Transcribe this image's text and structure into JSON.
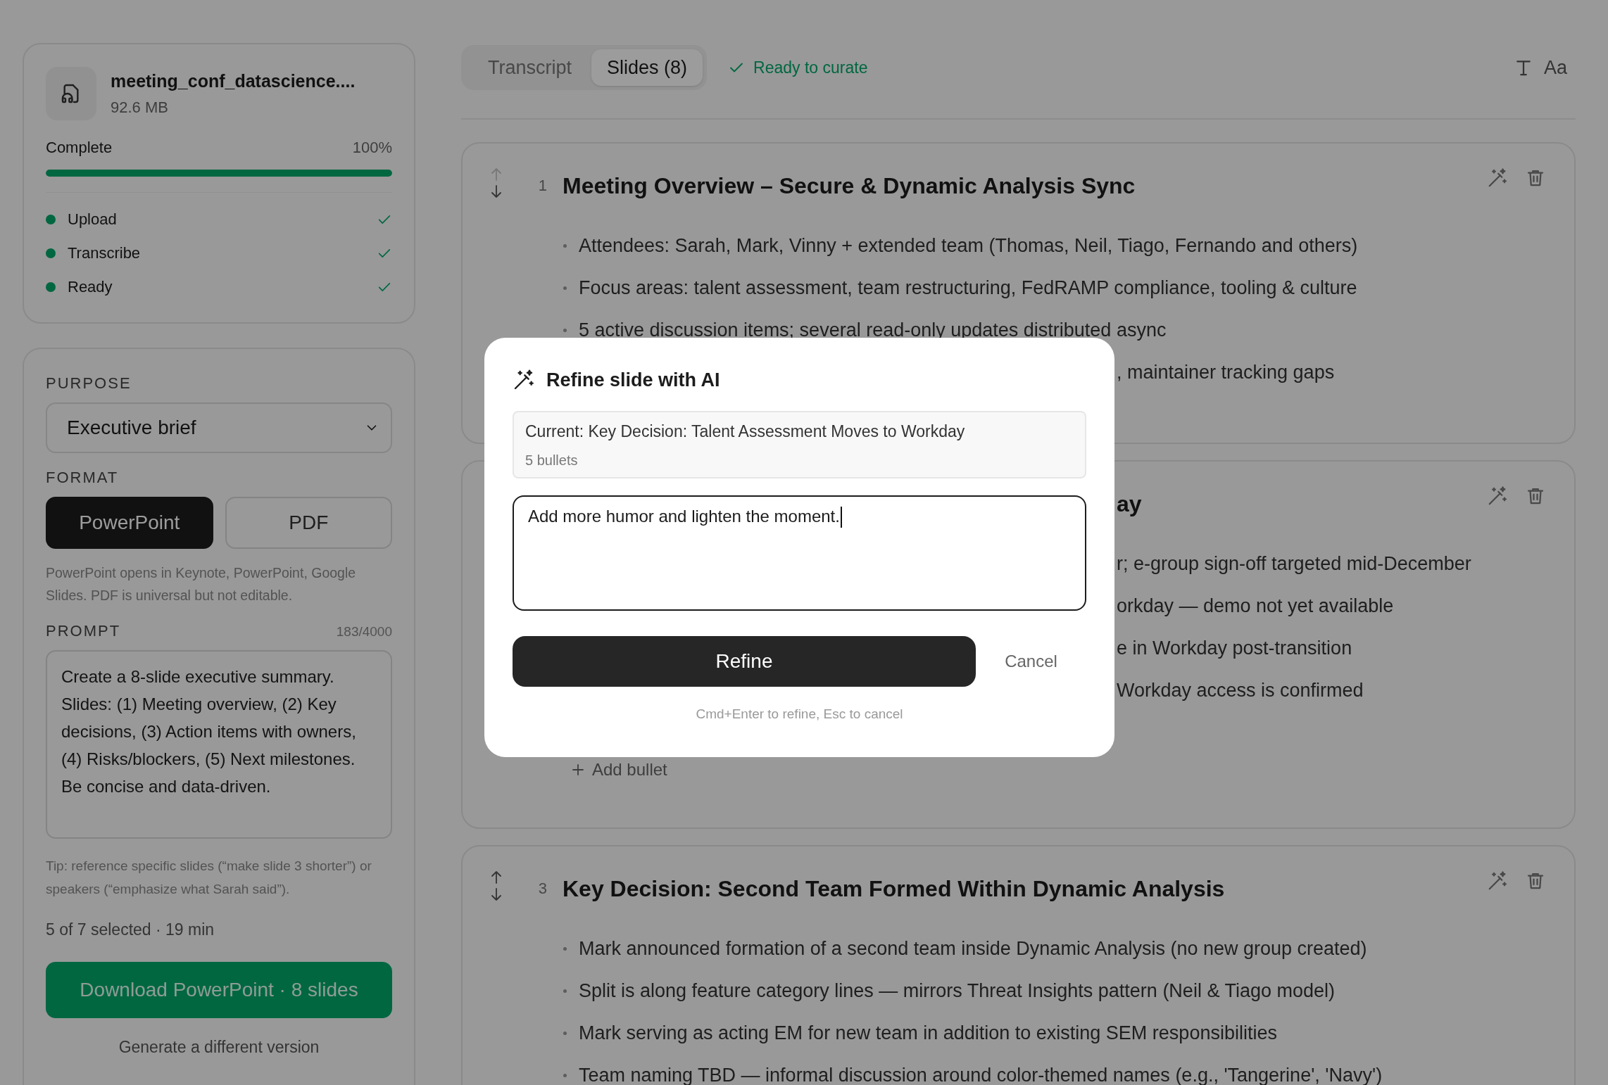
{
  "sidebar": {
    "file": {
      "name": "meeting_conf_datascience....",
      "size": "92.6 MB"
    },
    "progress": {
      "label": "Complete",
      "percent": "100%",
      "level": 1
    },
    "steps": [
      {
        "label": "Upload",
        "done": true
      },
      {
        "label": "Transcribe",
        "done": true
      },
      {
        "label": "Ready",
        "done": true
      }
    ]
  },
  "options": {
    "purpose": {
      "label": "PURPOSE",
      "value": "Executive brief"
    },
    "format": {
      "label": "FORMAT",
      "choices": [
        {
          "label": "PowerPoint",
          "selected": true
        },
        {
          "label": "PDF",
          "selected": false
        }
      ],
      "help": "PowerPoint opens in Keynote, PowerPoint, Google Slides. PDF is universal but not editable."
    },
    "prompt": {
      "label": "PROMPT",
      "count": "183/4000",
      "value": "Create a 8-slide executive summary. Slides: (1) Meeting overview, (2) Key decisions, (3) Action items with owners, (4) Risks/blockers, (5) Next milestones. Be concise and data-driven.",
      "tip": "Tip: reference specific slides (“make slide 3 shorter”) or speakers (“emphasize what Sarah said”)."
    },
    "selection": "5 of 7 selected · 19 min",
    "download_button": "Download PowerPoint · 8 slides",
    "regenerate_link": "Generate a different version"
  },
  "header": {
    "tabs": [
      {
        "label": "Transcript",
        "selected": false
      },
      {
        "label": "Slides (8)",
        "selected": true
      }
    ],
    "status": "Ready to curate",
    "font_button": "Aa"
  },
  "slides": [
    {
      "number": "1",
      "title": "Meeting Overview – Secure & Dynamic Analysis Sync",
      "title_clipped": false,
      "bullets": [
        {
          "text": "Attendees: Sarah, Mark, Vinny + extended team (Thomas, Neil, Tiago, Fernando and others)",
          "clipped": false
        },
        {
          "text": "Focus areas: talent assessment, team restructuring, FedRAMP compliance, tooling & culture",
          "clipped": false
        },
        {
          "text": "5 active discussion items; several read-only updates distributed async",
          "clipped": false
        },
        {
          "text": ", maintainer tracking gaps",
          "clipped": true
        }
      ]
    },
    {
      "title": "ay",
      "title_clipped": true,
      "bullets": [
        {
          "text": "r; e-group sign-off targeted mid-December",
          "clipped": true
        },
        {
          "text": "orkday — demo not yet available",
          "clipped": true
        },
        {
          "text": "e in Workday post-transition",
          "clipped": true
        },
        {
          "text": "Workday access is confirmed",
          "clipped": true
        }
      ],
      "add_bullet": "Add bullet"
    },
    {
      "number": "3",
      "title": "Key Decision: Second Team Formed Within Dynamic Analysis",
      "title_clipped": false,
      "bullets": [
        {
          "text": "Mark announced formation of a second team inside Dynamic Analysis (no new group created)",
          "clipped": false
        },
        {
          "text": "Split is along feature category lines — mirrors Threat Insights pattern (Neil & Tiago model)",
          "clipped": false
        },
        {
          "text": "Mark serving as acting EM for new team in addition to existing SEM responsibilities",
          "clipped": false
        },
        {
          "text": "Team naming TBD — informal discussion around color-themed names (e.g., 'Tangerine', 'Navy')",
          "clipped": false
        }
      ]
    }
  ],
  "dialog": {
    "title": "Refine slide with AI",
    "current": "Current: Key Decision: Talent Assessment Moves to Workday",
    "bullet_count": "5 bullets",
    "input": "Add more humor and lighten the moment.",
    "primary_button": "Refine",
    "cancel_button": "Cancel",
    "hint": "Cmd+Enter to refine, Esc to cancel"
  }
}
